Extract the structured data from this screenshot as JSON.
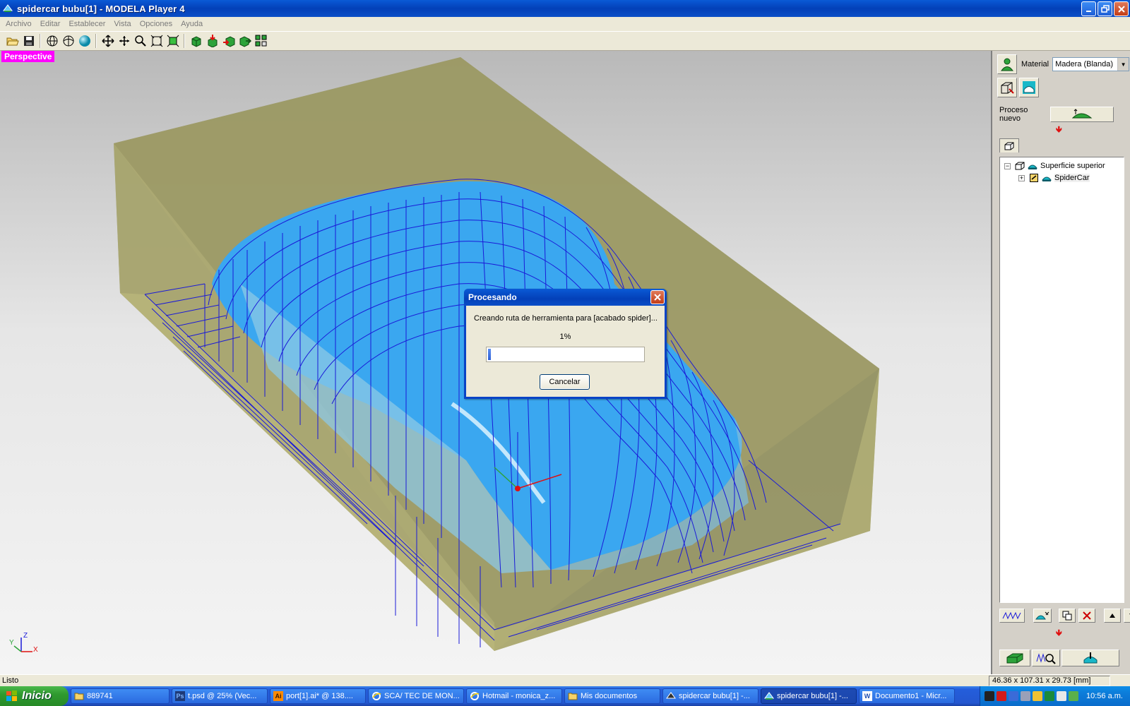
{
  "window": {
    "title": "spidercar bubu[1] - MODELA Player 4"
  },
  "menu": [
    "Archivo",
    "Editar",
    "Establecer",
    "Vista",
    "Opciones",
    "Ayuda"
  ],
  "viewport": {
    "view_label": "Perspective",
    "axes": {
      "x": "X",
      "y": "Y",
      "z": "Z"
    }
  },
  "dialog": {
    "title": "Procesando",
    "message": "Creando ruta de herramienta para [acabado spider]...",
    "percent_text": "1%",
    "progress": 0.02,
    "cancel_label": "Cancelar"
  },
  "right_panel": {
    "material_label": "Material",
    "material_value": "Madera (Blanda)",
    "new_process_label": "Proceso nuevo",
    "tree": [
      {
        "label": "Superficie superior",
        "expander": "−"
      },
      {
        "label": "SpiderCar",
        "expander": "+"
      }
    ]
  },
  "status": {
    "text": "Listo",
    "coords": "46.36 x 107.31 x 29.73 [mm]"
  },
  "taskbar": {
    "start_label": "Inicio",
    "tasks": [
      {
        "label": "889741",
        "icon": "folder-icon"
      },
      {
        "label": "t.psd @ 25% (Vec...",
        "icon": "photoshop-icon"
      },
      {
        "label": "port[1].ai* @ 138....",
        "icon": "illustrator-icon"
      },
      {
        "label": "SCA/ TEC DE MON...",
        "icon": "browser-icon"
      },
      {
        "label": "Hotmail - monica_z...",
        "icon": "browser-icon"
      },
      {
        "label": "Mis documentos",
        "icon": "folder-icon"
      },
      {
        "label": "spidercar bubu[1] -...",
        "icon": "modela-icon"
      },
      {
        "label": "spidercar bubu[1] -...",
        "icon": "modela-icon"
      },
      {
        "label": "Documento1 - Micr...",
        "icon": "word-icon"
      }
    ],
    "clock": "10:56 a.m."
  }
}
